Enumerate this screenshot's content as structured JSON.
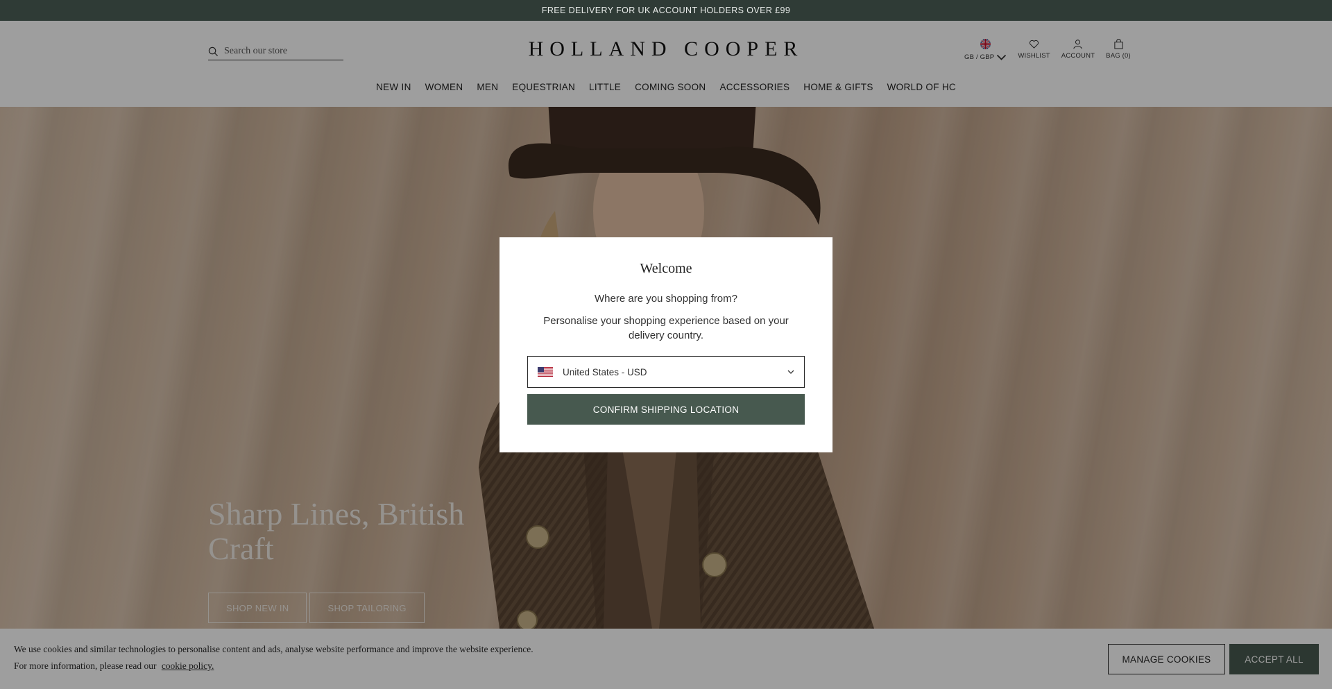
{
  "promo": {
    "text": "FREE DELIVERY FOR UK ACCOUNT HOLDERS OVER £99"
  },
  "header": {
    "search_placeholder": "Search our store",
    "logo": "HOLLAND COOPER",
    "utils": {
      "currency": "GB / GBP",
      "wishlist": "WISHLIST",
      "account": "ACCOUNT",
      "bag": "BAG (0)"
    },
    "nav": [
      "NEW IN",
      "WOMEN",
      "MEN",
      "EQUESTRIAN",
      "LITTLE",
      "COMING SOON",
      "ACCESSORIES",
      "HOME & GIFTS",
      "WORLD OF HC"
    ]
  },
  "hero": {
    "title": "Sharp Lines, British Craft",
    "buttons": [
      "SHOP NEW IN",
      "SHOP TAILORING"
    ]
  },
  "modal": {
    "title": "Welcome",
    "question": "Where are you shopping from?",
    "description": "Personalise your shopping experience based on your delivery country.",
    "selected_country": "United States - USD",
    "confirm_label": "CONFIRM SHIPPING LOCATION"
  },
  "cookie": {
    "line1": "We use cookies and similar technologies to personalise content and ads, analyse website performance and improve the website experience.",
    "line2": "For more information, please read our",
    "link": "cookie policy.",
    "manage_label": "MANAGE COOKIES",
    "accept_label": "ACCEPT ALL"
  },
  "colors": {
    "brand_dark": "#2f3b36",
    "button_green": "#47594f"
  },
  "icons": [
    "search-icon",
    "gb-flag-icon",
    "chevron-down-icon",
    "heart-icon",
    "user-icon",
    "bag-icon",
    "us-flag-icon"
  ]
}
